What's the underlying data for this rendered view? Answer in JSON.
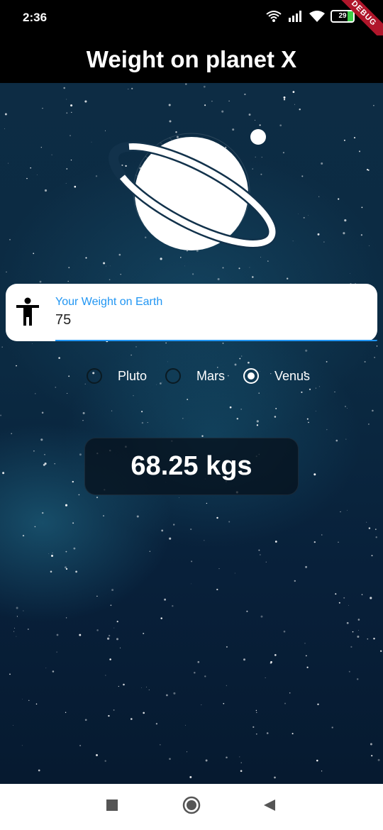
{
  "status_bar": {
    "time": "2:36",
    "battery_level": "29",
    "debug_label": "DEBUG",
    "icons": [
      "wifi-calling-icon",
      "signal-icon",
      "wifi-icon",
      "battery-icon"
    ]
  },
  "app_bar": {
    "title": "Weight on planet X"
  },
  "weight_input": {
    "label": "Your Weight on Earth",
    "value": "75",
    "icon": "person-accessibility-icon",
    "accent_color": "#2196f3"
  },
  "planet_options": [
    {
      "label": "Pluto",
      "selected": false
    },
    {
      "label": "Mars",
      "selected": false
    },
    {
      "label": "Venus",
      "selected": true
    }
  ],
  "result": {
    "text": "68.25 kgs"
  },
  "nav_bar": {
    "icons": [
      "recents-square-icon",
      "home-circle-icon",
      "back-triangle-icon"
    ]
  }
}
